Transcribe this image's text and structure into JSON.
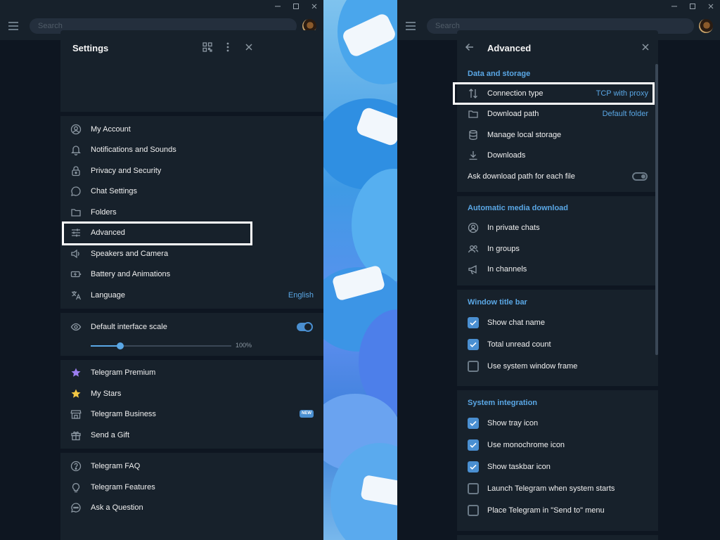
{
  "window": {
    "search_placeholder": "Search",
    "minimize_glyph": "—",
    "close_glyph": "✕"
  },
  "settings": {
    "title": "Settings",
    "menu": [
      {
        "label": "My Account",
        "icon": "account-icon"
      },
      {
        "label": "Notifications and Sounds",
        "icon": "bell-icon"
      },
      {
        "label": "Privacy and Security",
        "icon": "lock-icon"
      },
      {
        "label": "Chat Settings",
        "icon": "chat-icon"
      },
      {
        "label": "Folders",
        "icon": "folder-icon"
      },
      {
        "label": "Advanced",
        "icon": "sliders-icon"
      },
      {
        "label": "Speakers and Camera",
        "icon": "speaker-icon"
      },
      {
        "label": "Battery and Animations",
        "icon": "battery-icon"
      },
      {
        "label": "Language",
        "icon": "translate-icon",
        "value": "English"
      }
    ],
    "scale": {
      "label": "Default interface scale",
      "value_text": "100%",
      "fraction": 0.21,
      "enabled": true
    },
    "extras": [
      {
        "label": "Telegram Premium",
        "icon": "premium-star-icon"
      },
      {
        "label": "My Stars",
        "icon": "star-icon"
      },
      {
        "label": "Telegram Business",
        "icon": "business-icon",
        "badge": "NEW"
      },
      {
        "label": "Send a Gift",
        "icon": "gift-icon"
      }
    ],
    "help": [
      {
        "label": "Telegram FAQ",
        "icon": "question-icon"
      },
      {
        "label": "Telegram Features",
        "icon": "lightbulb-icon"
      },
      {
        "label": "Ask a Question",
        "icon": "chat-dots-icon"
      }
    ]
  },
  "advanced": {
    "title": "Advanced",
    "data_storage": {
      "heading": "Data and storage",
      "items": [
        {
          "label": "Connection type",
          "icon": "arrows-updown-icon",
          "value": "TCP with proxy"
        },
        {
          "label": "Download path",
          "icon": "folder-icon",
          "value": "Default folder"
        },
        {
          "label": "Manage local storage",
          "icon": "database-icon"
        },
        {
          "label": "Downloads",
          "icon": "download-icon"
        }
      ],
      "ask_path": {
        "label": "Ask download path for each file",
        "enabled": false
      }
    },
    "auto_media": {
      "heading": "Automatic media download",
      "items": [
        {
          "label": "In private chats",
          "icon": "user-circle-icon"
        },
        {
          "label": "In groups",
          "icon": "group-icon"
        },
        {
          "label": "In channels",
          "icon": "megaphone-icon"
        }
      ]
    },
    "title_bar": {
      "heading": "Window title bar",
      "items": [
        {
          "label": "Show chat name",
          "checked": true
        },
        {
          "label": "Total unread count",
          "checked": true
        },
        {
          "label": "Use system window frame",
          "checked": false
        }
      ]
    },
    "system": {
      "heading": "System integration",
      "items": [
        {
          "label": "Show tray icon",
          "checked": true
        },
        {
          "label": "Use monochrome icon",
          "checked": true
        },
        {
          "label": "Show taskbar icon",
          "checked": true
        },
        {
          "label": "Launch Telegram when system starts",
          "checked": false
        },
        {
          "label": "Place Telegram in \"Send to\" menu",
          "checked": false
        }
      ]
    }
  },
  "colors": {
    "accent": "#5aa7e5",
    "panel_bg": "#17212b",
    "window_bg": "#0e1621",
    "highlight_box": "#ffffff"
  }
}
